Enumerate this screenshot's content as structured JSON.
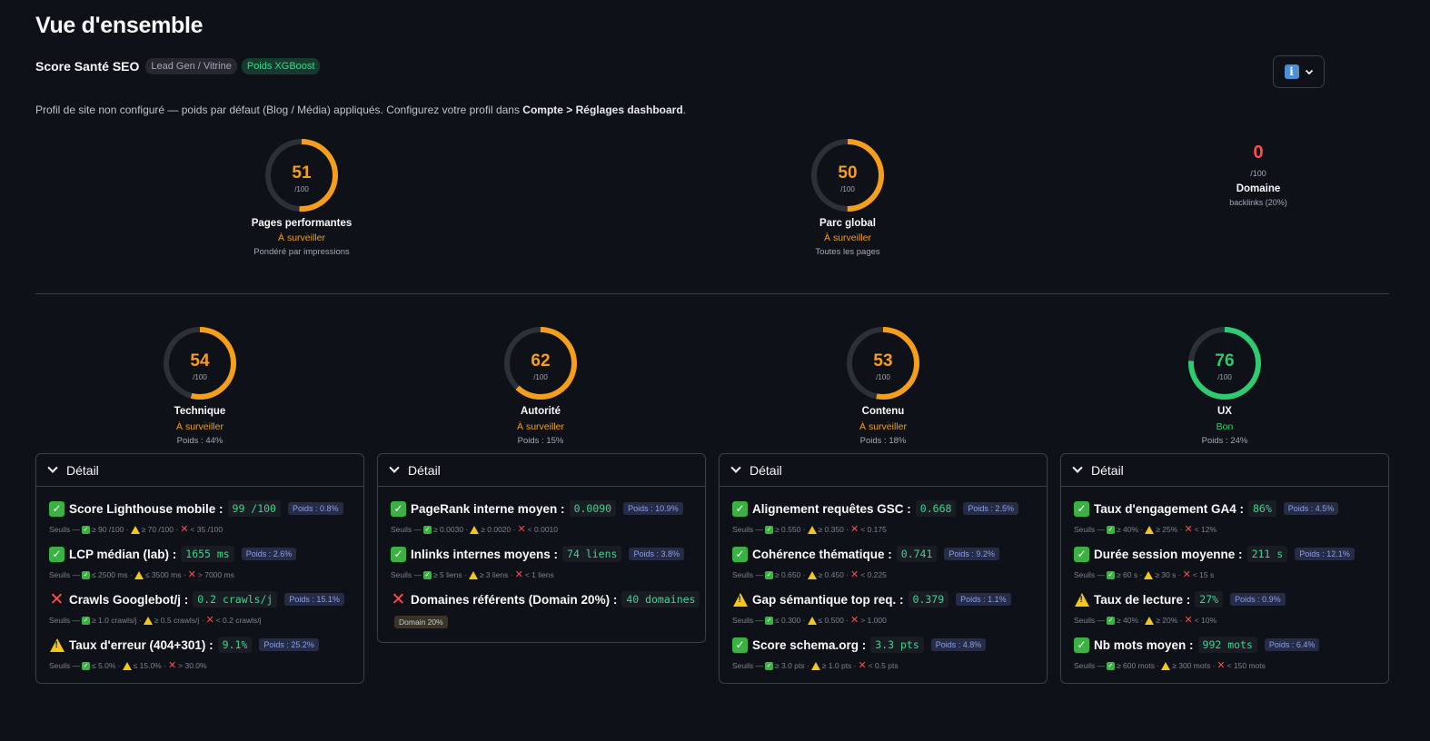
{
  "page": {
    "title": "Vue d'ensemble",
    "score_title": "Score Santé SEO",
    "badge_profile": "Lead Gen / Vitrine",
    "badge_xgb": "Poids XGBoost",
    "notice_text": "Profil de site non configuré — poids par défaut (Blog / Média) appliqués. Configurez votre profil dans ",
    "notice_bold": "Compte > Réglages dashboard",
    "notice_end": ".",
    "info_icon": "info-icon",
    "chevron_icon": "chevron-down-icon"
  },
  "colors": {
    "orange": "#f59e1b",
    "green": "#2ecc71",
    "red": "#ff4b4b",
    "track": "#2e3038"
  },
  "top_gauges": [
    {
      "value": 51,
      "value_text": "51",
      "den": "/100",
      "label": "Pages performantes",
      "status": "À surveiller",
      "status_color": "#f59e1b",
      "sub": "Pondéré par impressions"
    },
    {
      "value": 50,
      "value_text": "50",
      "den": "/100",
      "label": "Parc global",
      "status": "À surveiller",
      "status_color": "#f59e1b",
      "sub": "Toutes les pages"
    }
  ],
  "domain": {
    "value": "0",
    "den": "/100",
    "label": "Domaine",
    "sub": "backlinks (20%)"
  },
  "category_gauges": [
    {
      "value": 54,
      "value_text": "54",
      "den": "/100",
      "label": "Technique",
      "status": "À surveiller",
      "status_color": "#f59e1b",
      "sub": "Poids : 44%"
    },
    {
      "value": 62,
      "value_text": "62",
      "den": "/100",
      "label": "Autorité",
      "status": "À surveiller",
      "status_color": "#f59e1b",
      "sub": "Poids : 15%"
    },
    {
      "value": 53,
      "value_text": "53",
      "den": "/100",
      "label": "Contenu",
      "status": "À surveiller",
      "status_color": "#f59e1b",
      "sub": "Poids : 18%"
    },
    {
      "value": 76,
      "value_text": "76",
      "den": "/100",
      "label": "UX",
      "status": "Bon",
      "status_color": "#2ecc71",
      "sub": "Poids : 24%"
    }
  ],
  "panels": [
    {
      "title": "Détail",
      "metrics": [
        {
          "status": "ok",
          "name": "Score Lighthouse mobile :",
          "value": "99 /100",
          "weight": "Poids : 0.8%",
          "t_prefix": "Seuils —",
          "t_ok": "≥ 90 /100 ·",
          "t_warn": "≥ 70 /100 ·",
          "t_bad": "< 35 /100"
        },
        {
          "status": "ok",
          "name": "LCP médian (lab) :",
          "value": "1655 ms",
          "weight": "Poids : 2.6%",
          "t_prefix": "Seuils —",
          "t_ok": "≤ 2500 ms ·",
          "t_warn": "≤ 3500 ms ·",
          "t_bad": "> 7000 ms"
        },
        {
          "status": "bad",
          "name": "Crawls Googlebot/j :",
          "value": "0.2 crawls/j",
          "weight": "Poids : 15.1%",
          "t_prefix": "Seuils —",
          "t_ok": "≥ 1.0 crawls/j ·",
          "t_warn": "≥ 0.5 crawls/j ·",
          "t_bad": "< 0.2 crawls/j"
        },
        {
          "status": "warn",
          "name": "Taux d'erreur (404+301) :",
          "value": "9.1%",
          "weight": "Poids : 25.2%",
          "t_prefix": "Seuils —",
          "t_ok": "≤ 5.0% ·",
          "t_warn": "≤ 15.0% ·",
          "t_bad": "> 30.0%"
        }
      ]
    },
    {
      "title": "Détail",
      "metrics": [
        {
          "status": "ok",
          "name": "PageRank interne moyen :",
          "value": "0.0090",
          "weight": "Poids : 10.9%",
          "t_prefix": "Seuils —",
          "t_ok": "≥ 0.0030 ·",
          "t_warn": "≥ 0.0020 ·",
          "t_bad": "< 0.0010"
        },
        {
          "status": "ok",
          "name": "Inlinks internes moyens :",
          "value": "74 liens",
          "weight": "Poids : 3.8%",
          "t_prefix": "Seuils —",
          "t_ok": "≥ 5 liens ·",
          "t_warn": "≥ 3 liens ·",
          "t_bad": "< 1 liens"
        },
        {
          "status": "bad",
          "name": "Domaines référents (Domain 20%) :",
          "value": "40 domaines",
          "weight": "",
          "tag": "Domain 20%"
        }
      ]
    },
    {
      "title": "Détail",
      "metrics": [
        {
          "status": "ok",
          "name": "Alignement requêtes GSC :",
          "value": "0.668",
          "weight": "Poids : 2.5%",
          "t_prefix": "Seuils —",
          "t_ok": "≥ 0.550 ·",
          "t_warn": "≥ 0.350 ·",
          "t_bad": "< 0.175"
        },
        {
          "status": "ok",
          "name": "Cohérence thématique :",
          "value": "0.741",
          "weight": "Poids : 9.2%",
          "t_prefix": "Seuils —",
          "t_ok": "≥ 0.650 ·",
          "t_warn": "≥ 0.450 ·",
          "t_bad": "< 0.225"
        },
        {
          "status": "warn",
          "name": "Gap sémantique top req. :",
          "value": "0.379",
          "weight": "Poids : 1.1%",
          "t_prefix": "Seuils —",
          "t_ok": "≤ 0.300 ·",
          "t_warn": "≤ 0.500 ·",
          "t_bad": "> 1.000"
        },
        {
          "status": "ok",
          "name": "Score schema.org :",
          "value": "3.3 pts",
          "weight": "Poids : 4.8%",
          "t_prefix": "Seuils —",
          "t_ok": "≥ 3.0 pts ·",
          "t_warn": "≥ 1.0 pts ·",
          "t_bad": "< 0.5 pts"
        }
      ]
    },
    {
      "title": "Détail",
      "metrics": [
        {
          "status": "ok",
          "name": "Taux d'engagement GA4 :",
          "value": "86%",
          "weight": "Poids : 4.5%",
          "t_prefix": "Seuils —",
          "t_ok": "≥ 40% ·",
          "t_warn": "≥ 25% ·",
          "t_bad": "< 12%"
        },
        {
          "status": "ok",
          "name": "Durée session moyenne :",
          "value": "211 s",
          "weight": "Poids : 12.1%",
          "t_prefix": "Seuils —",
          "t_ok": "≥ 60 s ·",
          "t_warn": "≥ 30 s ·",
          "t_bad": "< 15 s"
        },
        {
          "status": "warn",
          "name": "Taux de lecture :",
          "value": "27%",
          "weight": "Poids : 0.9%",
          "t_prefix": "Seuils —",
          "t_ok": "≥ 40% ·",
          "t_warn": "≥ 20% ·",
          "t_bad": "< 10%"
        },
        {
          "status": "ok",
          "name": "Nb mots moyen :",
          "value": "992 mots",
          "weight": "Poids : 6.4%",
          "t_prefix": "Seuils —",
          "t_ok": "≥ 600 mots ·",
          "t_warn": "≥ 300 mots ·",
          "t_bad": "< 150 mots"
        }
      ]
    }
  ]
}
